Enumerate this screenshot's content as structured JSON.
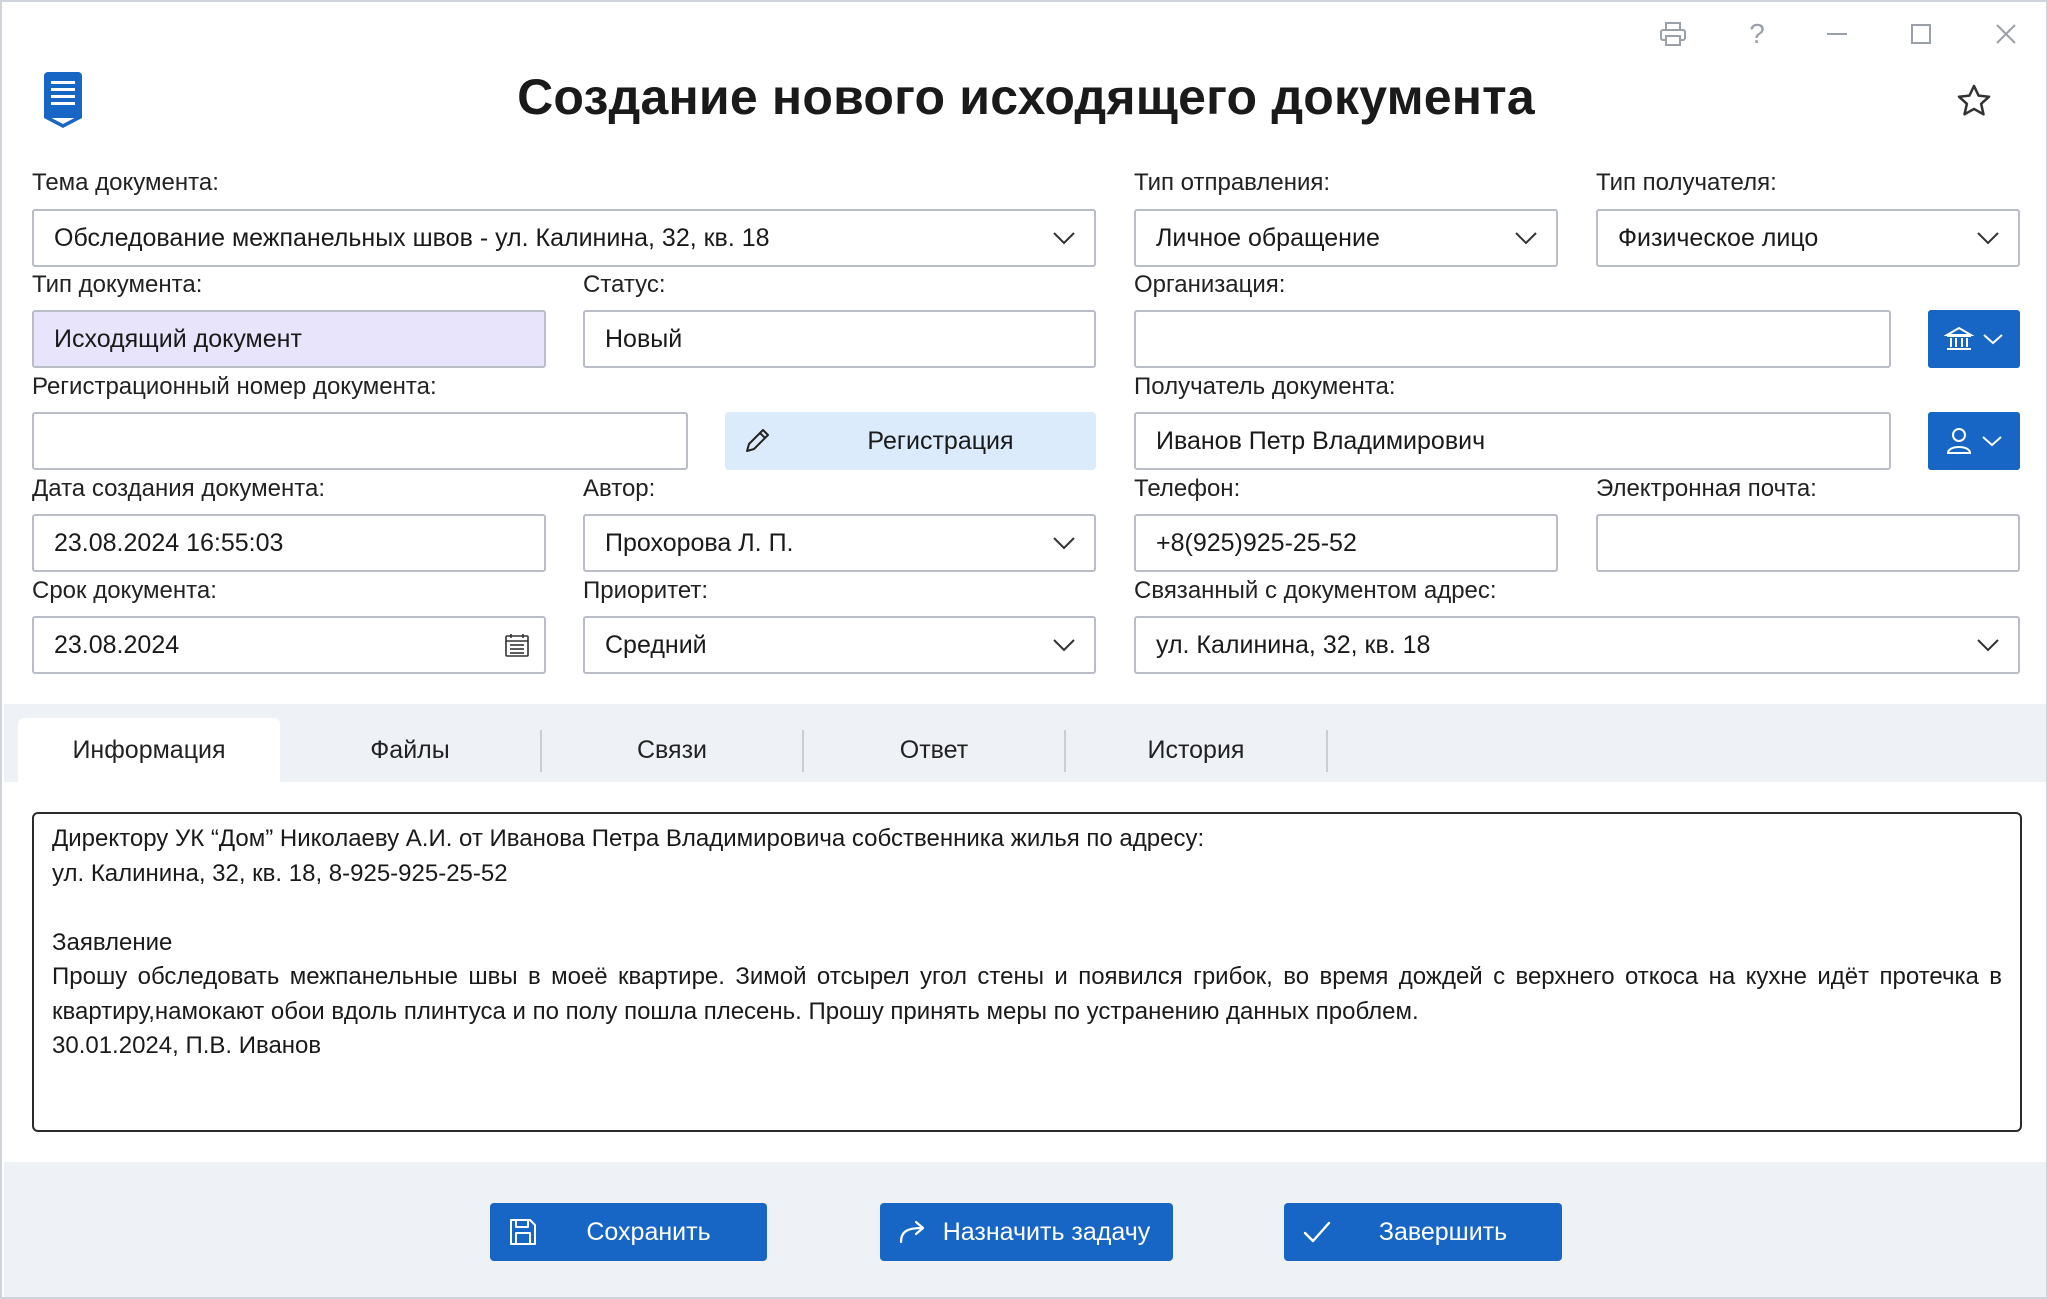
{
  "window": {
    "title": "Создание нового исходящего документа",
    "controls": [
      "print-icon",
      "help-icon",
      "minimize-icon",
      "maximize-icon",
      "close-icon"
    ],
    "help_glyph": "?"
  },
  "form": {
    "topic": {
      "label": "Тема документа:",
      "value": "Обследование межпанельных швов - ул. Калинина, 32, кв. 18"
    },
    "send_type": {
      "label": "Тип отправления:",
      "value": "Личное обращение"
    },
    "recipient_type": {
      "label": "Тип получателя:",
      "value": "Физическое лицо"
    },
    "doc_type": {
      "label": "Тип документа:",
      "value": "Исходящий документ"
    },
    "status": {
      "label": "Статус:",
      "value": "Новый"
    },
    "organization": {
      "label": "Организация:",
      "value": ""
    },
    "reg_number": {
      "label": "Регистрационный номер документа:",
      "value": ""
    },
    "register_button": "Регистрация",
    "recipient": {
      "label": "Получатель документа:",
      "value": "Иванов Петр Владимирович"
    },
    "created": {
      "label": "Дата создания документа:",
      "value": "23.08.2024 16:55:03"
    },
    "author": {
      "label": "Автор:",
      "value": "Прохорова Л. П."
    },
    "phone": {
      "label": "Телефон:",
      "value": "+8(925)925-25-52"
    },
    "email": {
      "label": "Электронная почта:",
      "value": ""
    },
    "deadline": {
      "label": "Срок документа:",
      "value": "23.08.2024"
    },
    "priority": {
      "label": "Приоритет:",
      "value": "Средний"
    },
    "address": {
      "label": "Связанный с документом адрес:",
      "value": "ул. Калинина, 32, кв. 18"
    }
  },
  "tabs": [
    {
      "label": "Информация",
      "active": true
    },
    {
      "label": "Файлы",
      "active": false
    },
    {
      "label": "Связи",
      "active": false
    },
    {
      "label": "Ответ",
      "active": false
    },
    {
      "label": "История",
      "active": false
    }
  ],
  "info_text": {
    "line1": "Директору УК “Дом” Николаеву А.И. от Иванова Петра Владимировича собственника жилья по адресу:",
    "line2": "ул. Калинина, 32, кв. 18, 8-925-925-25-52",
    "line3": "Заявление",
    "line4": "Прошу обследовать межпанельные швы в моеё квартире. Зимой отсырел угол стены и появился грибок, во время дождей с верхнего откоса на кухне идёт протечка в квартиру,намокают обои вдоль плинтуса и по полу пошла плесень. Прошу принять меры по устранению данных проблем.",
    "line5": "30.01.2024, П.В. Иванов"
  },
  "footer": {
    "save": "Сохранить",
    "assign": "Назначить задачу",
    "finish": "Завершить"
  },
  "colors": {
    "accent": "#1766c5",
    "register_button_bg": "#dcebfb",
    "doc_type_bg": "#e7e4fb",
    "panel_bg": "#eef1f6"
  }
}
